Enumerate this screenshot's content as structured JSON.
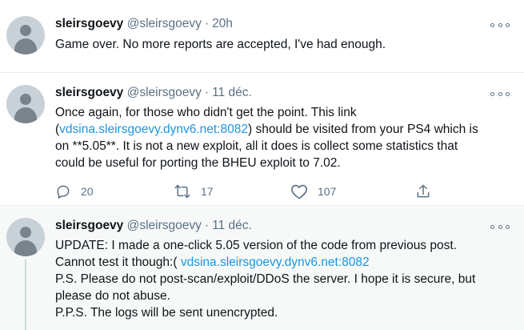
{
  "tweets": [
    {
      "name": "sleirsgoevy",
      "handle": "@sleirsgoevy",
      "separator": "·",
      "time": "20h",
      "lines": [
        "Game over. No more reports are accepted, I've had enough."
      ]
    },
    {
      "name": "sleirsgoevy",
      "handle": "@sleirsgoevy",
      "separator": "·",
      "time": "11 déc.",
      "line1": "Once again, for those who didn't get the point. This link",
      "line2_open": "(",
      "line2_link": "vdsina.sleirsgoevy.dynv6.net:8082",
      "line2_rest": ") should be visited from your PS4 which is",
      "line3": "on **5.05**. It is not a new exploit, all it does is collect some statistics that",
      "line4": "could be useful for porting the BHEU exploit to 7.02.",
      "replies": "20",
      "retweets": "17",
      "likes": "107"
    },
    {
      "name": "sleirsgoevy",
      "handle": "@sleirsgoevy",
      "separator": "·",
      "time": "11 déc.",
      "line1": "UPDATE: I made a one-click 5.05 version of the code from previous post.",
      "line2_text": "Cannot test it though:( ",
      "line2_link": "vdsina.sleirsgoevy.dynv6.net:8082",
      "line3": "P.S. Please do not post-scan/exploit/DDoS the server. I hope it is secure, but",
      "line4": "please do not abuse.",
      "line5": "P.P.S. The logs will be sent unencrypted."
    }
  ],
  "icons": {
    "reply": "reply-icon",
    "retweet": "retweet-icon",
    "like": "heart-icon",
    "share": "share-icon",
    "more": "more-icon",
    "avatar": "default-avatar"
  },
  "colors": {
    "link": "#1b95e0",
    "secondary_text": "#5b7083",
    "highlight_bg": "#f7f9f9"
  }
}
